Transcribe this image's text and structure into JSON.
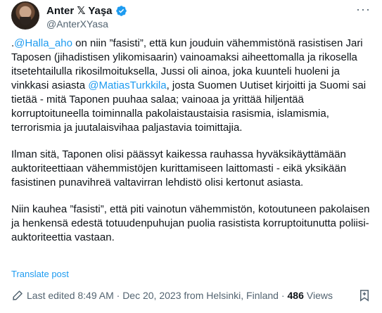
{
  "author": {
    "name": "Anter 𝕏 Yaşa",
    "handle": "@AnterXYasa"
  },
  "tweet": {
    "p1_prefix": ".",
    "p1_mention1": "@Halla_aho",
    "p1_mid": " on niin ”fasisti”, että kun jouduin vähemmistönä rasistisen Jari Taposen (jihadistisen ylikomisaarin) vainoamaksi aiheettomalla ja rikosella itsetehtailulla rikosilmoituksella, Jussi oli ainoa, joka kuunteli huoleni ja vinkkasi asiasta ",
    "p1_mention2": "@MatiasTurkkila",
    "p1_suffix": ", josta Suomen Uutiset kirjoitti ja Suomi sai tietää - mitä Taponen puuhaa salaa; vainoaa ja yrittää hiljentää korruptoituneella toiminnalla pakolaistaustaisia rasismia, islamismia, terrorismia ja juutalaisvihaa paljastavia toimittajia.",
    "p2": "Ilman sitä, Taponen olisi päässyt kaikessa rauhassa hyväksikäyttämään auktoriteettiaan vähemmistöjen kurittamiseen laittomasti - eikä yksikään fasistinen punavihreä valtavirran lehdistö olisi kertonut asiasta.",
    "p3": "Niin kauhea ”fasisti”, että piti vainotun vähemmistön, kotoutuneen pakolaisen ja henkensä edestä totuudenpuhujan puolia rasistista korruptoitunutta poliisi-auktoriteettia vastaan."
  },
  "translate_label": "Translate post",
  "meta": {
    "edited_text": "Last edited 8:49 AM · Dec 20, 2023 from Helsinki, Finland ·",
    "views_count": "486",
    "views_label": "Views"
  },
  "colors": {
    "accent": "#1d9bf0",
    "muted": "#536471",
    "text": "#0f1419"
  },
  "icons": {
    "verified": "verified-badge-icon",
    "more": "more-icon",
    "edit": "edit-pencil-icon",
    "bookmark": "bookmark-icon"
  }
}
